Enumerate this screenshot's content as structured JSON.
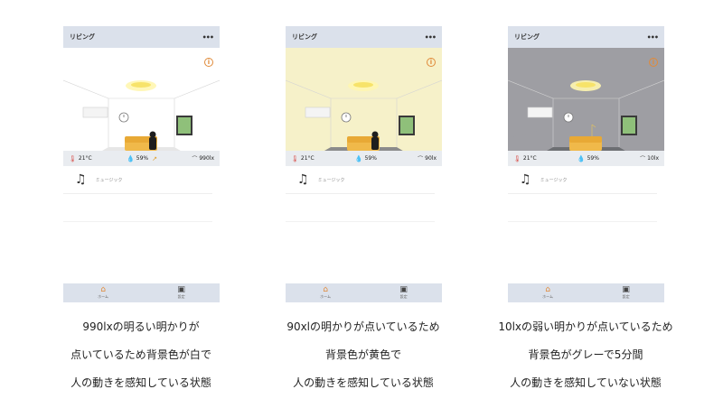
{
  "panels": [
    {
      "title": "リビング",
      "more": "•••",
      "room_bg": "#ffffff",
      "floor_color": "#e6e6e6",
      "temp": "21°C",
      "humidity": "59%",
      "lux": "990lx",
      "music_label": "ミュージック",
      "tab_home": "ホーム",
      "tab_tools": "設定"
    },
    {
      "title": "リビング",
      "more": "•••",
      "room_bg": "#f6f1c9",
      "floor_color": "#8b8b8b",
      "temp": "21°C",
      "humidity": "59%",
      "lux": "90lx",
      "music_label": "ミュージック",
      "tab_home": "ホーム",
      "tab_tools": "設定"
    },
    {
      "title": "リビング",
      "more": "•••",
      "room_bg": "#9e9ea3",
      "floor_color": "#6d6f73",
      "temp": "21°C",
      "humidity": "59%",
      "lux": "10lx",
      "music_label": "ミュージック",
      "tab_home": "ホーム",
      "tab_tools": "設定"
    }
  ],
  "captions": [
    [
      "990lxの明るい明かりが",
      "点いているため背景色が白で",
      "人の動きを感知している状態"
    ],
    [
      "90xlの明かりが点いているため",
      "背景色が黄色で",
      "人の動きを感知している状態"
    ],
    [
      "10lxの弱い明かりが点いているため",
      "背景色がグレーで5分間",
      "人の動きを感知していない状態"
    ]
  ],
  "icons": {
    "info": "info-icon",
    "thermometer": "thermometer-icon",
    "humidity": "droplet-icon",
    "light": "ceiling-light-icon",
    "music": "music-note-icon",
    "home": "home-icon",
    "toolbox": "toolbox-icon"
  }
}
